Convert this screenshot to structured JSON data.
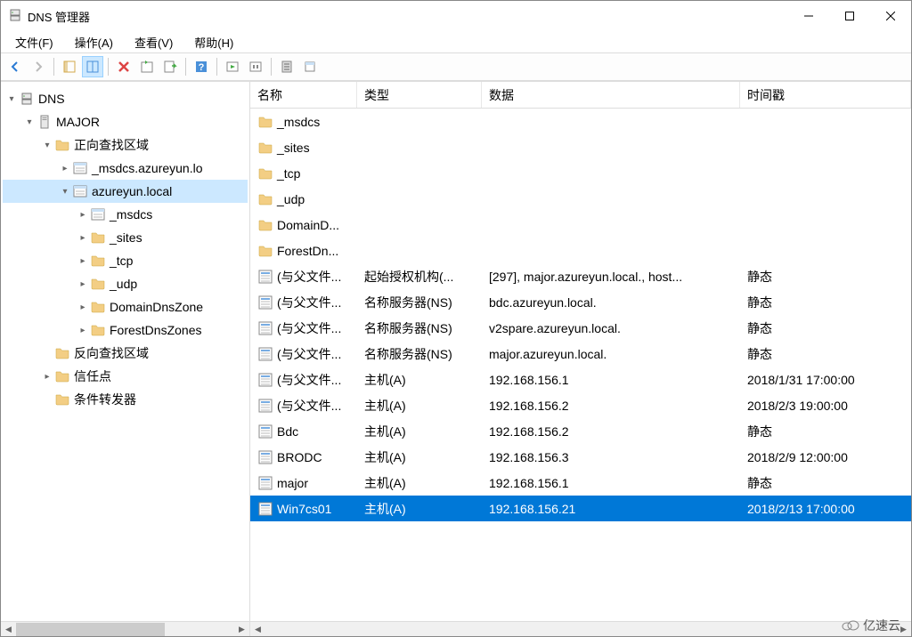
{
  "window": {
    "title": "DNS 管理器"
  },
  "menu": {
    "file": "文件(F)",
    "action": "操作(A)",
    "view": "查看(V)",
    "help": "帮助(H)"
  },
  "tree": {
    "root": "DNS",
    "server": "MAJOR",
    "fwd_zones": "正向查找区域",
    "zone1": "_msdcs.azureyun.lo",
    "zone2": "azureyun.local",
    "z2_msdcs": "_msdcs",
    "z2_sites": "_sites",
    "z2_tcp": "_tcp",
    "z2_udp": "_udp",
    "z2_ddz": "DomainDnsZone",
    "z2_fdz": "ForestDnsZones",
    "rev_zones": "反向查找区域",
    "trust_points": "信任点",
    "cond_fwd": "条件转发器"
  },
  "columns": {
    "name": "名称",
    "type": "类型",
    "data": "数据",
    "timestamp": "时间戳"
  },
  "records": [
    {
      "icon": "folder",
      "name": "_msdcs",
      "type": "",
      "data": "",
      "time": ""
    },
    {
      "icon": "folder",
      "name": "_sites",
      "type": "",
      "data": "",
      "time": ""
    },
    {
      "icon": "folder",
      "name": "_tcp",
      "type": "",
      "data": "",
      "time": ""
    },
    {
      "icon": "folder",
      "name": "_udp",
      "type": "",
      "data": "",
      "time": ""
    },
    {
      "icon": "folder",
      "name": "DomainD...",
      "type": "",
      "data": "",
      "time": ""
    },
    {
      "icon": "folder",
      "name": "ForestDn...",
      "type": "",
      "data": "",
      "time": ""
    },
    {
      "icon": "record",
      "name": "(与父文件...",
      "type": "起始授权机构(...",
      "data": "[297], major.azureyun.local., host...",
      "time": "静态"
    },
    {
      "icon": "record",
      "name": "(与父文件...",
      "type": "名称服务器(NS)",
      "data": "bdc.azureyun.local.",
      "time": "静态"
    },
    {
      "icon": "record",
      "name": "(与父文件...",
      "type": "名称服务器(NS)",
      "data": "v2spare.azureyun.local.",
      "time": "静态"
    },
    {
      "icon": "record",
      "name": "(与父文件...",
      "type": "名称服务器(NS)",
      "data": "major.azureyun.local.",
      "time": "静态"
    },
    {
      "icon": "record",
      "name": "(与父文件...",
      "type": "主机(A)",
      "data": "192.168.156.1",
      "time": "2018/1/31 17:00:00"
    },
    {
      "icon": "record",
      "name": "(与父文件...",
      "type": "主机(A)",
      "data": "192.168.156.2",
      "time": "2018/2/3 19:00:00"
    },
    {
      "icon": "record",
      "name": "Bdc",
      "type": "主机(A)",
      "data": "192.168.156.2",
      "time": "静态"
    },
    {
      "icon": "record",
      "name": "BRODC",
      "type": "主机(A)",
      "data": "192.168.156.3",
      "time": "2018/2/9 12:00:00"
    },
    {
      "icon": "record",
      "name": "major",
      "type": "主机(A)",
      "data": "192.168.156.1",
      "time": "静态"
    },
    {
      "icon": "record",
      "name": "Win7cs01",
      "type": "主机(A)",
      "data": "192.168.156.21",
      "time": "2018/2/13 17:00:00",
      "selected": true
    }
  ],
  "logo": "亿速云"
}
